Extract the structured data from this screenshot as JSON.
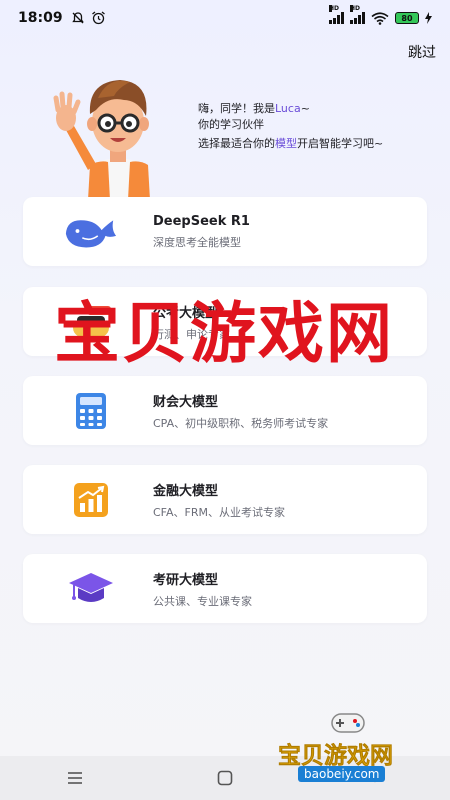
{
  "status_bar": {
    "time": "18:09",
    "battery": "80"
  },
  "header": {
    "skip_label": "跳过"
  },
  "greeting": {
    "line1_prefix": "嗨，同学！我是",
    "name": "Luca",
    "line1_suffix": "~",
    "line2": "你的学习伙伴",
    "line3_prefix": "选择最适合你的",
    "line3_highlight": "模型",
    "line3_suffix": "开启智能学习吧~"
  },
  "models": [
    {
      "title": "DeepSeek R1",
      "subtitle": "深度思考全能模型",
      "icon": "whale-icon"
    },
    {
      "title": "公考大模型",
      "subtitle": "行测、申论专家",
      "icon": "civil-exam-icon"
    },
    {
      "title": "财会大模型",
      "subtitle": "CPA、初中级职称、税务师考试专家",
      "icon": "calculator-icon"
    },
    {
      "title": "金融大模型",
      "subtitle": "CFA、FRM、从业考试专家",
      "icon": "chart-growth-icon"
    },
    {
      "title": "考研大模型",
      "subtitle": "公共课、专业课专家",
      "icon": "graduation-cap-icon"
    }
  ],
  "watermark": {
    "text": "宝贝游戏网",
    "small_text": "宝贝游戏网",
    "url": "baobeiy.com"
  },
  "colors": {
    "accent": "#6a4dd8",
    "whale_blue": "#4b6fe0",
    "watermark_red": "#e0141e"
  }
}
